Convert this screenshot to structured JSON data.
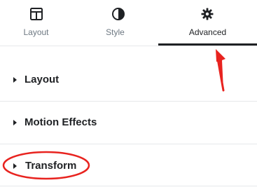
{
  "tabs": [
    {
      "label": "Layout",
      "icon": "columns-layout-icon"
    },
    {
      "label": "Style",
      "icon": "half-circle-contrast-icon"
    },
    {
      "label": "Advanced",
      "icon": "gear-icon",
      "active": true
    }
  ],
  "sections": [
    {
      "title": "Layout",
      "expanded": false
    },
    {
      "title": "Motion Effects",
      "expanded": false
    },
    {
      "title": "Transform",
      "expanded": false
    }
  ],
  "colors": {
    "annotation": "#e8231f",
    "text": "#1f2124",
    "muted": "#6d7882",
    "divider": "#e6e8ea"
  }
}
